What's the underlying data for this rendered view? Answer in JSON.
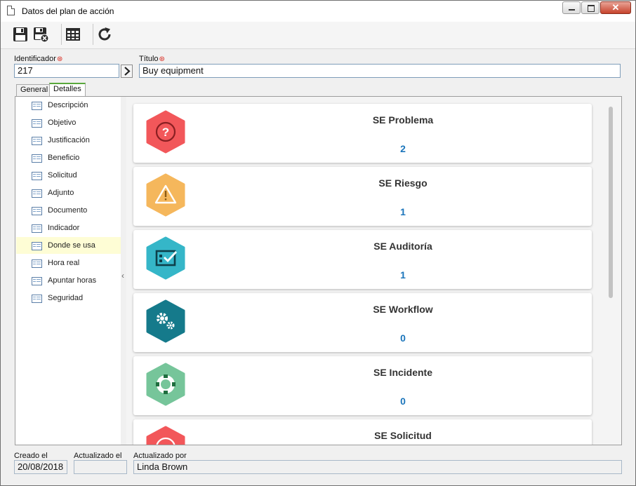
{
  "window": {
    "title": "Datos del plan de acción",
    "close_label": "✕"
  },
  "toolbar": {
    "buttons": [
      {
        "name": "save-icon"
      },
      {
        "name": "save-and-close-icon"
      },
      {
        "name": "grid-icon"
      },
      {
        "name": "refresh-icon"
      }
    ]
  },
  "header": {
    "id_label": "Identificador",
    "id_value": "217",
    "title_label": "Título",
    "title_value": "Buy equipment",
    "required_mark": "⊛"
  },
  "tabs": [
    {
      "label": "General",
      "active": false
    },
    {
      "label": "Detalles",
      "active": true
    }
  ],
  "sidebar": {
    "items": [
      {
        "label": "Descripción"
      },
      {
        "label": "Objetivo"
      },
      {
        "label": "Justificación"
      },
      {
        "label": "Beneficio"
      },
      {
        "label": "Solicitud"
      },
      {
        "label": "Adjunto"
      },
      {
        "label": "Documento"
      },
      {
        "label": "Indicador"
      },
      {
        "label": "Donde se usa",
        "active": true
      },
      {
        "label": "Hora real"
      },
      {
        "label": "Apuntar horas"
      },
      {
        "label": "Seguridad"
      }
    ],
    "collapse_glyph": "‹"
  },
  "cards": [
    {
      "title": "SE Problema",
      "count": "2",
      "color": "#f2575a",
      "icon": "question-icon"
    },
    {
      "title": "SE Riesgo",
      "count": "1",
      "color": "#f5b75c",
      "icon": "warning-icon"
    },
    {
      "title": "SE Auditoría",
      "count": "1",
      "color": "#35b6c8",
      "icon": "audit-checklist-icon"
    },
    {
      "title": "SE Workflow",
      "count": "0",
      "color": "#157a8b",
      "icon": "gears-icon"
    },
    {
      "title": "SE Incidente",
      "count": "0",
      "color": "#76c59a",
      "icon": "lifebuoy-icon"
    },
    {
      "title": "SE Solicitud",
      "count": "",
      "color": "#f2575a",
      "icon": "request-icon"
    }
  ],
  "footer": {
    "created_label": "Creado el",
    "created_value": "20/08/2018",
    "updated_label": "Actualizado el",
    "updated_value": "",
    "updated_by_label": "Actualizado por",
    "updated_by_value": "Linda Brown"
  }
}
